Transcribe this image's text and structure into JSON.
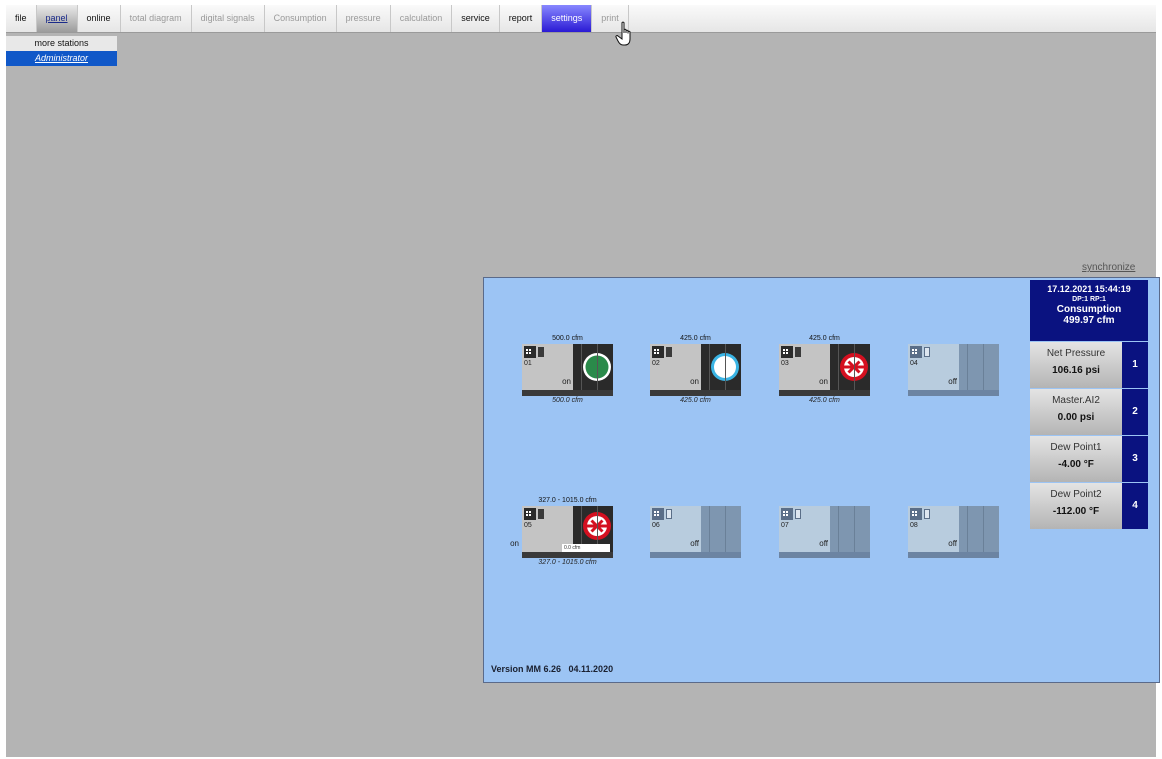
{
  "menu": {
    "items": [
      {
        "label": "file"
      },
      {
        "label": "panel"
      },
      {
        "label": "online"
      },
      {
        "label": "total diagram"
      },
      {
        "label": "digital signals"
      },
      {
        "label": "Consumption"
      },
      {
        "label": "pressure"
      },
      {
        "label": "calculation"
      },
      {
        "label": "service"
      },
      {
        "label": "report"
      },
      {
        "label": "settings"
      },
      {
        "label": "print"
      }
    ],
    "active": "panel",
    "hovered": "settings"
  },
  "dropdown": {
    "items": [
      {
        "label": "more stations"
      },
      {
        "label": "Administrator"
      }
    ],
    "selected": "Administrator"
  },
  "sync_link": "synchronize",
  "header": {
    "datetime": "17.12.2021  15:44:19",
    "dp_rp": "DP:1 RP:1",
    "consumption_label": "Consumption",
    "consumption_value": "499.97 cfm"
  },
  "sensors": [
    {
      "name": "Net Pressure",
      "value": "106.16 psi",
      "index": "1"
    },
    {
      "name": "Master.AI2",
      "value": "0.00 psi",
      "index": "2"
    },
    {
      "name": "Dew Point1",
      "value": "-4.00 °F",
      "index": "3"
    },
    {
      "name": "Dew Point2",
      "value": "-112.00 °F",
      "index": "4"
    }
  ],
  "compressors": [
    {
      "num": "01",
      "state": "on",
      "top": "500.0 cfm",
      "bottom": "500.0 cfm",
      "status_icon": "running-green-ring-icon"
    },
    {
      "num": "02",
      "state": "on",
      "top": "425.0 cfm",
      "bottom": "425.0 cfm",
      "status_icon": "idle-blue-ring-icon"
    },
    {
      "num": "03",
      "state": "on",
      "top": "425.0 cfm",
      "bottom": "425.0 cfm",
      "status_icon": "fault-red-cross-icon"
    },
    {
      "num": "04",
      "state": "off",
      "top": "",
      "bottom": "",
      "status_icon": ""
    },
    {
      "num": "05",
      "state": "on",
      "top": "327.0 - 1015.0 cfm",
      "bottom": "327.0 - 1015.0 cfm",
      "flow": "0.0 cfm",
      "status_icon": "fault-red-cross-icon"
    },
    {
      "num": "06",
      "state": "off",
      "top": "",
      "bottom": "",
      "status_icon": ""
    },
    {
      "num": "07",
      "state": "off",
      "top": "",
      "bottom": "",
      "status_icon": ""
    },
    {
      "num": "08",
      "state": "off",
      "top": "",
      "bottom": "",
      "status_icon": ""
    }
  ],
  "version": "Version MM 6.26   04.11.2020",
  "colors": {
    "background": "#b4b4b4",
    "panel_bg": "#9cc4f4",
    "header_bg": "#0a1280",
    "settings_highlight": "#2a1ad4",
    "dropdown_active": "#1058c8",
    "running": "#2a8a4a",
    "idle": "#3ab4e4",
    "fault": "#d41020"
  }
}
